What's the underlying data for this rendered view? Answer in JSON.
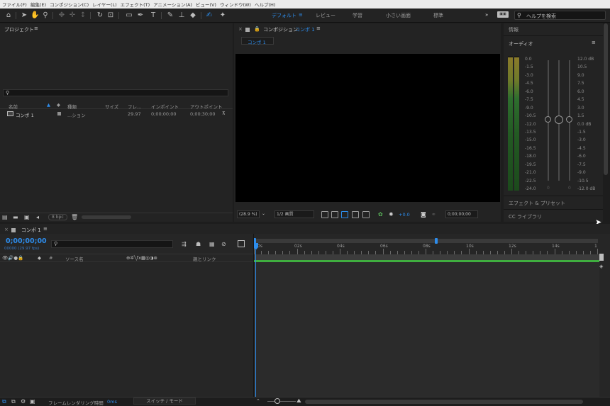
{
  "menu": [
    "ファイル(F)",
    "編集(E)",
    "コンポジション(C)",
    "レイヤー(L)",
    "エフェクト(T)",
    "アニメーション(A)",
    "ビュー(V)",
    "ウィンドウ(W)",
    "ヘルプ(H)"
  ],
  "workspaces": {
    "default": "デフォルト",
    "review": "レビュー",
    "learn": "学習",
    "small_screen": "小さい画面",
    "standard": "標準"
  },
  "help_search": {
    "placeholder": "ヘルプを検索"
  },
  "project": {
    "title": "プロジェクト",
    "columns": {
      "name": "名前",
      "type": "種類",
      "size": "サイズ",
      "frame": "フレ...",
      "in_point": "インポイント",
      "out_point": "アウトポイント"
    },
    "item": {
      "name": "コンポ 1",
      "type": "...ション",
      "frame": "29.97",
      "in_point": "0;00;00;00",
      "out_point": "0;00;30;00"
    },
    "bpc": "8 bpc"
  },
  "composition": {
    "title_prefix": "コンポジション",
    "title_name": "コンポ 1",
    "tab": "コンポ 1",
    "zoom": "(28.9 %)",
    "resolution": "1/2 画質",
    "exposure": "+0.0",
    "timecode": "0;00;00;00"
  },
  "right": {
    "info": "情報",
    "audio": "オーディオ",
    "effects": "エフェクト & プリセット",
    "libraries": "CC ライブラリ",
    "left_scale": [
      "0.0",
      "-1.5",
      "-3.0",
      "-4.5",
      "-6.0",
      "-7.5",
      "-9.0",
      "-10.5",
      "-12.0",
      "-13.5",
      "-15.0",
      "-16.5",
      "-18.0",
      "-19.5",
      "-21.0",
      "-22.5",
      "-24.0"
    ],
    "right_scale": [
      "12.0 dB",
      "10.5",
      "9.0",
      "7.5",
      "6.0",
      "4.5",
      "3.0",
      "1.5",
      "0.0 dB",
      "-1.5",
      "-3.0",
      "-4.5",
      "-6.0",
      "-7.5",
      "-9.0",
      "-10.5",
      "-12.0 dB"
    ],
    "slider_zero_left": "0",
    "slider_zero_right": "0"
  },
  "timeline": {
    "tab": "コンポ 1",
    "timecode": "0;00;00;00",
    "fps": "00000 (29.97 fps)",
    "source_name": "ソース名",
    "parent_link": "親とリンク",
    "ruler": [
      "0s",
      "02s",
      "04s",
      "06s",
      "08s",
      "10s",
      "12s",
      "14s",
      "1"
    ],
    "render_time_label": "フレームレンダリング時間",
    "render_time_value": "0ms",
    "switch_mode": "スイッチ / モード"
  },
  "colors": {
    "accent": "#2d8ceb",
    "panel": "#232323",
    "bg": "#1d1d1d",
    "meter_green": "#2e7d32",
    "meter_yellow": "#8a7a2a",
    "work_area": "#3fae3f"
  }
}
